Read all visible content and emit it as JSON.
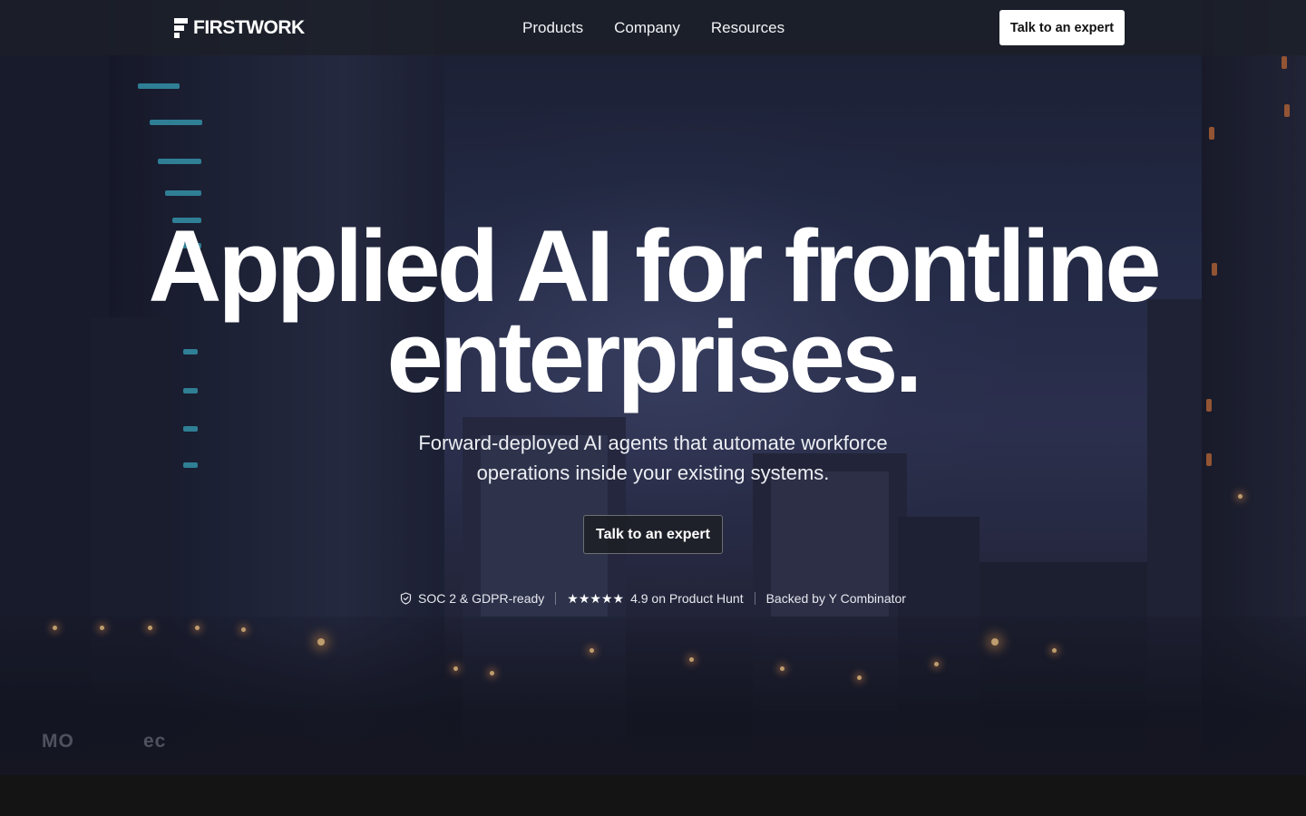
{
  "brand": {
    "name": "FIRSTWORK"
  },
  "nav": {
    "links": [
      {
        "label": "Products"
      },
      {
        "label": "Company"
      },
      {
        "label": "Resources"
      }
    ],
    "cta_label": "Talk to an expert"
  },
  "hero": {
    "headline_line1": "Applied AI for frontline",
    "headline_line2": "enterprises.",
    "subhead_line1": "Forward-deployed AI agents that automate workforce",
    "subhead_line2": "operations inside your existing systems.",
    "cta_label": "Talk to an expert"
  },
  "trust": {
    "security": "SOC 2 & GDPR-ready",
    "stars": "★★★★★",
    "rating": "4.9 on Product Hunt",
    "backing": "Backed by Y Combinator"
  },
  "background": {
    "sign_left": "MO",
    "sign_right": "ec"
  },
  "colors": {
    "accent_cyan": "#3ec0d8",
    "nav_bg": "#1c2028",
    "button_bg": "#ffffff",
    "page_bg": "#141414"
  }
}
